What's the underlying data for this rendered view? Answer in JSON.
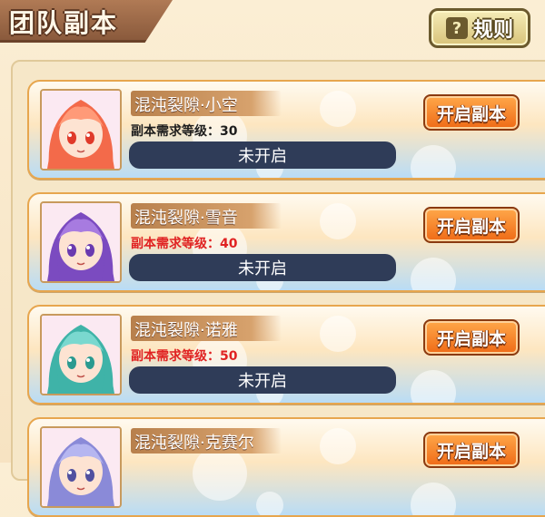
{
  "header": {
    "title": "团队副本"
  },
  "rules_button": {
    "label": "规则",
    "icon": "question-icon"
  },
  "colors": {
    "card_border": "#e7a64e",
    "status_bar": "#2f3c58",
    "open_button": "#ef6a16",
    "requirement_unmet": "#e02222"
  },
  "dungeons": [
    {
      "name": "混沌裂隙·小空",
      "requirement": "副本需求等级：30",
      "requirement_met": true,
      "status": "未开启",
      "button": "开启副本",
      "hair": "#f36a4a",
      "hair_light": "#ff9a78",
      "eyes": "#e03a2a"
    },
    {
      "name": "混沌裂隙·雪音",
      "requirement": "副本需求等级：40",
      "requirement_met": false,
      "status": "未开启",
      "button": "开启副本",
      "hair": "#7b4bc0",
      "hair_light": "#a77be0",
      "eyes": "#6a3ab0"
    },
    {
      "name": "混沌裂隙·诺雅",
      "requirement": "副本需求等级：50",
      "requirement_met": false,
      "status": "未开启",
      "button": "开启副本",
      "hair": "#3fb3a8",
      "hair_light": "#7ad8cf",
      "eyes": "#2a9a90"
    },
    {
      "name": "混沌裂隙·克赛尔",
      "requirement": "",
      "requirement_met": false,
      "status": "",
      "button": "开启副本",
      "hair": "#8a8ad8",
      "hair_light": "#b6b6f0",
      "eyes": "#5050a0"
    }
  ]
}
